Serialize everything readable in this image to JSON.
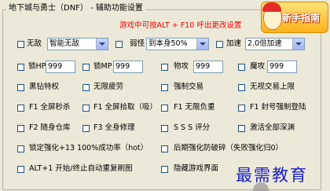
{
  "window": {
    "group_title": "地下城与勇士（DNF） - 辅助功能设置"
  },
  "hint": "游戏中可按ALT + F10 呼出更改设置",
  "logo": {
    "label": "新手指南"
  },
  "row1": {
    "invincible": {
      "label": "无敌",
      "value": "智能无敌"
    },
    "weak": {
      "label": "弱怪",
      "value": "到本身50%"
    },
    "speed": {
      "label": "加速",
      "value": "2.0倍加速"
    }
  },
  "row2": {
    "lock_hp": {
      "label": "锁HP",
      "value": "999"
    },
    "lock_mp": {
      "label": "锁MP",
      "value": "999"
    },
    "phys_atk": {
      "label": "物攻",
      "value": "999"
    },
    "mag_atk": {
      "label": "魔攻",
      "value": "999"
    }
  },
  "checks": {
    "c1": "黑钻特权",
    "c2": "无限疲劳",
    "c3": "强制交易",
    "c4": "无视交易上限",
    "c5": "F1 全屏秒杀",
    "c6": "F1 全屏拾取（吸）",
    "c7": "F1 无限负重",
    "c8": "F1 封号强制登陆",
    "c9": "F2 随身仓库",
    "c10": "F3 全身修理",
    "c11": "S S S 评分",
    "c12": "激活全部深渊",
    "c13": "锁定强化+13 100%成功率（hot）",
    "c14": "后期强化防破碎（失败强化归0）",
    "c15": "ALT+1 开始/终止自动重复刷图",
    "c16": "隐藏游戏界面"
  },
  "watermark": "最需教育"
}
